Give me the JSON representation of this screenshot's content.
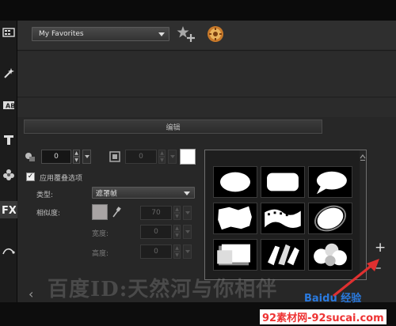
{
  "favorites": {
    "selected": "My Favorites",
    "add_icon": "star-plus-icon",
    "options_icon": "gear-circle-icon"
  },
  "toolbar_icons": [
    "media-icon",
    "instant-project-icon",
    "transition-icon",
    "title-icon",
    "graphic-icon",
    "filter-icon",
    "path-icon"
  ],
  "edit_label": "编辑",
  "border": {
    "value": "0",
    "icon": "border-icon"
  },
  "shadow": {
    "value": "0"
  },
  "overlay_checkbox": {
    "label": "应用覆叠选项",
    "checked": true
  },
  "type": {
    "label": "类型:",
    "value": "遮罩帧"
  },
  "similarity": {
    "label": "相似度:",
    "value": "70"
  },
  "width": {
    "label": "宽度:",
    "value": "0"
  },
  "height": {
    "label": "高度:",
    "value": "0"
  },
  "mask_frames": [
    "ellipse",
    "rounded-rect",
    "speech-bubble",
    "torn-paper",
    "film-strip",
    "splash",
    "brush-rect",
    "broken-shards",
    "bubbles"
  ],
  "controls": {
    "add": "+",
    "remove": "–",
    "back": "‹"
  },
  "colors": {
    "accent": "#e03030",
    "background": "#272727"
  },
  "watermark": "百度ID:天然河与你相伴",
  "logo": "Baidu 经验",
  "site": "92素材网-92sucai.com"
}
